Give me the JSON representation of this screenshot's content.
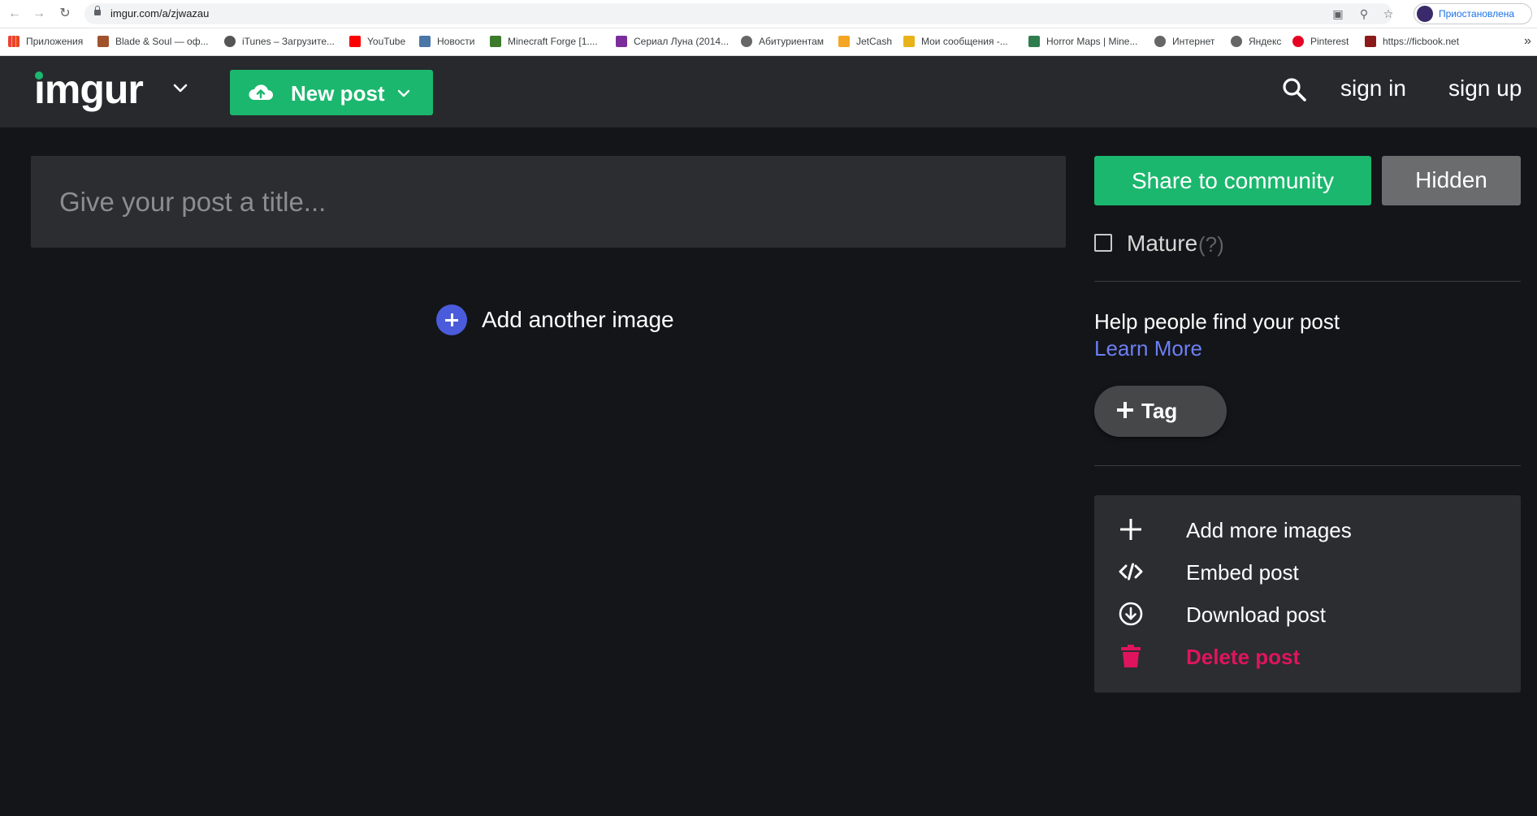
{
  "browser": {
    "url": "imgur.com/a/zjwazau",
    "profile_label": "Приостановлена",
    "bookmarks": [
      {
        "label": "Приложения",
        "icon": "apps-grid-icon"
      },
      {
        "label": "Blade & Soul — оф...",
        "icon": "blade-soul-icon"
      },
      {
        "label": "iTunes – Загрузите...",
        "icon": "apple-icon"
      },
      {
        "label": "YouTube",
        "icon": "youtube-icon"
      },
      {
        "label": "Новости",
        "icon": "vk-icon"
      },
      {
        "label": "Minecraft Forge [1....",
        "icon": "minecraft-icon"
      },
      {
        "label": "Сериал Луна (2014...",
        "icon": "series-icon"
      },
      {
        "label": "Абитуриентам",
        "icon": "globe-icon"
      },
      {
        "label": "JetCash",
        "icon": "jetcash-icon"
      },
      {
        "label": "Мои сообщения -...",
        "icon": "messages-icon"
      },
      {
        "label": "Horror Maps | Mine...",
        "icon": "horror-maps-icon"
      },
      {
        "label": "Интернет",
        "icon": "globe-icon"
      },
      {
        "label": "Яндекс",
        "icon": "globe-icon"
      },
      {
        "label": "Pinterest",
        "icon": "pinterest-icon"
      },
      {
        "label": "https://ficbook.net",
        "icon": "ficbook-icon"
      }
    ]
  },
  "header": {
    "logo": "imgur",
    "new_post_label": "New post",
    "sign_in_label": "sign in",
    "sign_up_label": "sign up"
  },
  "editor": {
    "title_placeholder": "Give your post a title...",
    "add_another_image_label": "Add another image"
  },
  "sidebar": {
    "share_label": "Share to community",
    "visibility_label": "Hidden",
    "mature_label": "Mature",
    "mature_help": "(?)",
    "mature_checked": false,
    "help_text": "Help people find your post",
    "learn_more_label": "Learn More",
    "tag_label": "Tag",
    "actions": [
      {
        "label": "Add more images",
        "icon": "plus-icon"
      },
      {
        "label": "Embed post",
        "icon": "code-icon"
      },
      {
        "label": "Download post",
        "icon": "download-icon"
      },
      {
        "label": "Delete post",
        "icon": "trash-icon"
      }
    ]
  },
  "colors": {
    "accent_green": "#1bb76e",
    "link_blue": "#6c7ff5",
    "danger": "#e0145e",
    "plus_circle": "#4a5cdb",
    "background": "#141518",
    "header_bg": "#27292d"
  }
}
